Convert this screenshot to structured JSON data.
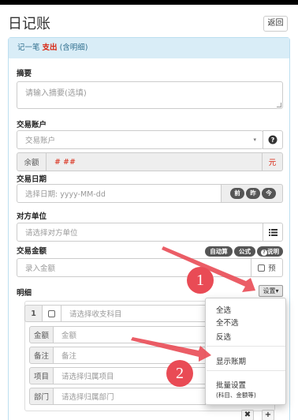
{
  "header": {
    "title": "日记账",
    "back_label": "返回"
  },
  "panel": {
    "prefix": "记一笔",
    "type": "支出",
    "suffix": "(含明细)"
  },
  "summary": {
    "label": "摘要",
    "placeholder": "请输入摘要(选填)"
  },
  "account": {
    "label": "交易账户",
    "placeholder": "交易账户",
    "balance_label": "余额",
    "balance_value": "# ##",
    "currency": "元"
  },
  "date": {
    "label": "交易日期",
    "placeholder": "选择日期: yyyy-MM-dd",
    "btn_before_yesterday": "前",
    "btn_yesterday": "昨",
    "btn_today": "今"
  },
  "counterparty": {
    "label": "对方单位",
    "placeholder": "请选择对方单位"
  },
  "amount": {
    "label": "交易金额",
    "placeholder": "录入金额",
    "btn_auto": "自动算",
    "btn_formula": "公式",
    "btn_help": "说明",
    "prepay_label": "预"
  },
  "detail": {
    "label": "明细",
    "settings_label": "设置",
    "row_index": "1",
    "subject_placeholder": "请选择收支科目",
    "fields": [
      {
        "label": "金额",
        "placeholder": "金额"
      },
      {
        "label": "备注",
        "placeholder": "备注"
      },
      {
        "label": "项目",
        "placeholder": "请选择归属项目"
      },
      {
        "label": "部门",
        "placeholder": "请选择归属部门"
      }
    ],
    "remove_label": "✖",
    "add_label": "+"
  },
  "dropdown": {
    "items": [
      "全选",
      "全不选",
      "反选",
      "显示账期",
      "批量设置"
    ],
    "batch_hint": "(科目、金额等)"
  },
  "annotations": {
    "step1": "1",
    "step2": "2"
  },
  "colors": {
    "accent_red": "#d9230f",
    "panel_head": "#d9edf7",
    "arrow": "#e94b55"
  }
}
